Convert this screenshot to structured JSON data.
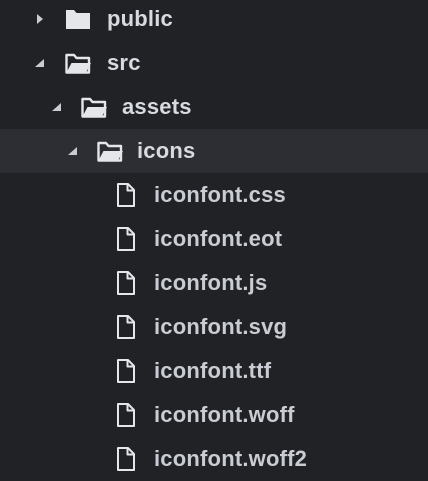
{
  "tree": {
    "items": [
      {
        "label": "public",
        "icon": "folder-closed-icon",
        "expanded": false
      },
      {
        "label": "src",
        "icon": "folder-open-icon",
        "expanded": true
      },
      {
        "label": "assets",
        "icon": "folder-open-icon",
        "expanded": true
      },
      {
        "label": "icons",
        "icon": "folder-open-icon",
        "expanded": true,
        "selected": true
      },
      {
        "label": "iconfont.css",
        "icon": "file-icon"
      },
      {
        "label": "iconfont.eot",
        "icon": "file-icon"
      },
      {
        "label": "iconfont.js",
        "icon": "file-icon"
      },
      {
        "label": "iconfont.svg",
        "icon": "file-icon"
      },
      {
        "label": "iconfont.ttf",
        "icon": "file-icon"
      },
      {
        "label": "iconfont.woff",
        "icon": "file-icon"
      },
      {
        "label": "iconfont.woff2",
        "icon": "file-icon"
      }
    ]
  },
  "colors": {
    "background": "#202226",
    "selected_row": "#2c2e33",
    "text": "#d7dae0",
    "icon": "#e4e6ea"
  }
}
